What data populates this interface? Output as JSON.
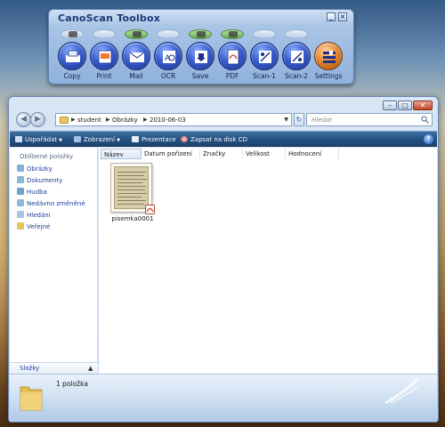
{
  "toolbox": {
    "title": "CanoScan Toolbox",
    "minimize_symbol": "_",
    "close_symbol": "×",
    "buttons": [
      {
        "label": "Copy",
        "icon": "copy-icon",
        "active": false
      },
      {
        "label": "Print",
        "icon": "print-icon",
        "active": false
      },
      {
        "label": "Mail",
        "icon": "mail-icon",
        "active": false
      },
      {
        "label": "OCR",
        "icon": "ocr-icon",
        "active": false
      },
      {
        "label": "Save",
        "icon": "save-icon",
        "active": true
      },
      {
        "label": "PDF",
        "icon": "pdf-icon",
        "active": true
      },
      {
        "label": "Scan-1",
        "icon": "scan-icon",
        "active": false
      },
      {
        "label": "Scan-2",
        "icon": "scan-icon",
        "active": false
      },
      {
        "label": "Settings",
        "icon": "settings-icon",
        "active": false
      }
    ]
  },
  "explorer": {
    "breadcrumb": [
      "student",
      "Obrázky",
      "2010-06-03"
    ],
    "search_placeholder": "Hledat",
    "commands": {
      "organize": "Uspořádat",
      "views": "Zobrazení",
      "slideshow": "Prezentace",
      "burn": "Zapsat na disk CD"
    },
    "nav": {
      "favorites_heading": "Oblíbené položky",
      "items": [
        "Obrázky",
        "Dokumenty",
        "Hudba",
        "Nedávno změněné",
        "Hledání",
        "Veřejné"
      ],
      "folders_label": "Složky"
    },
    "columns": [
      "Název",
      "Datum pořízení",
      "Značky",
      "Velikost",
      "Hodnocení"
    ],
    "files": [
      {
        "name": "pisemka0001"
      }
    ],
    "status": "1 položka"
  },
  "colors": {
    "toolbox_title": "#1b3b78",
    "command_bar": "#24507e",
    "nav_link": "#1e3f9a"
  }
}
